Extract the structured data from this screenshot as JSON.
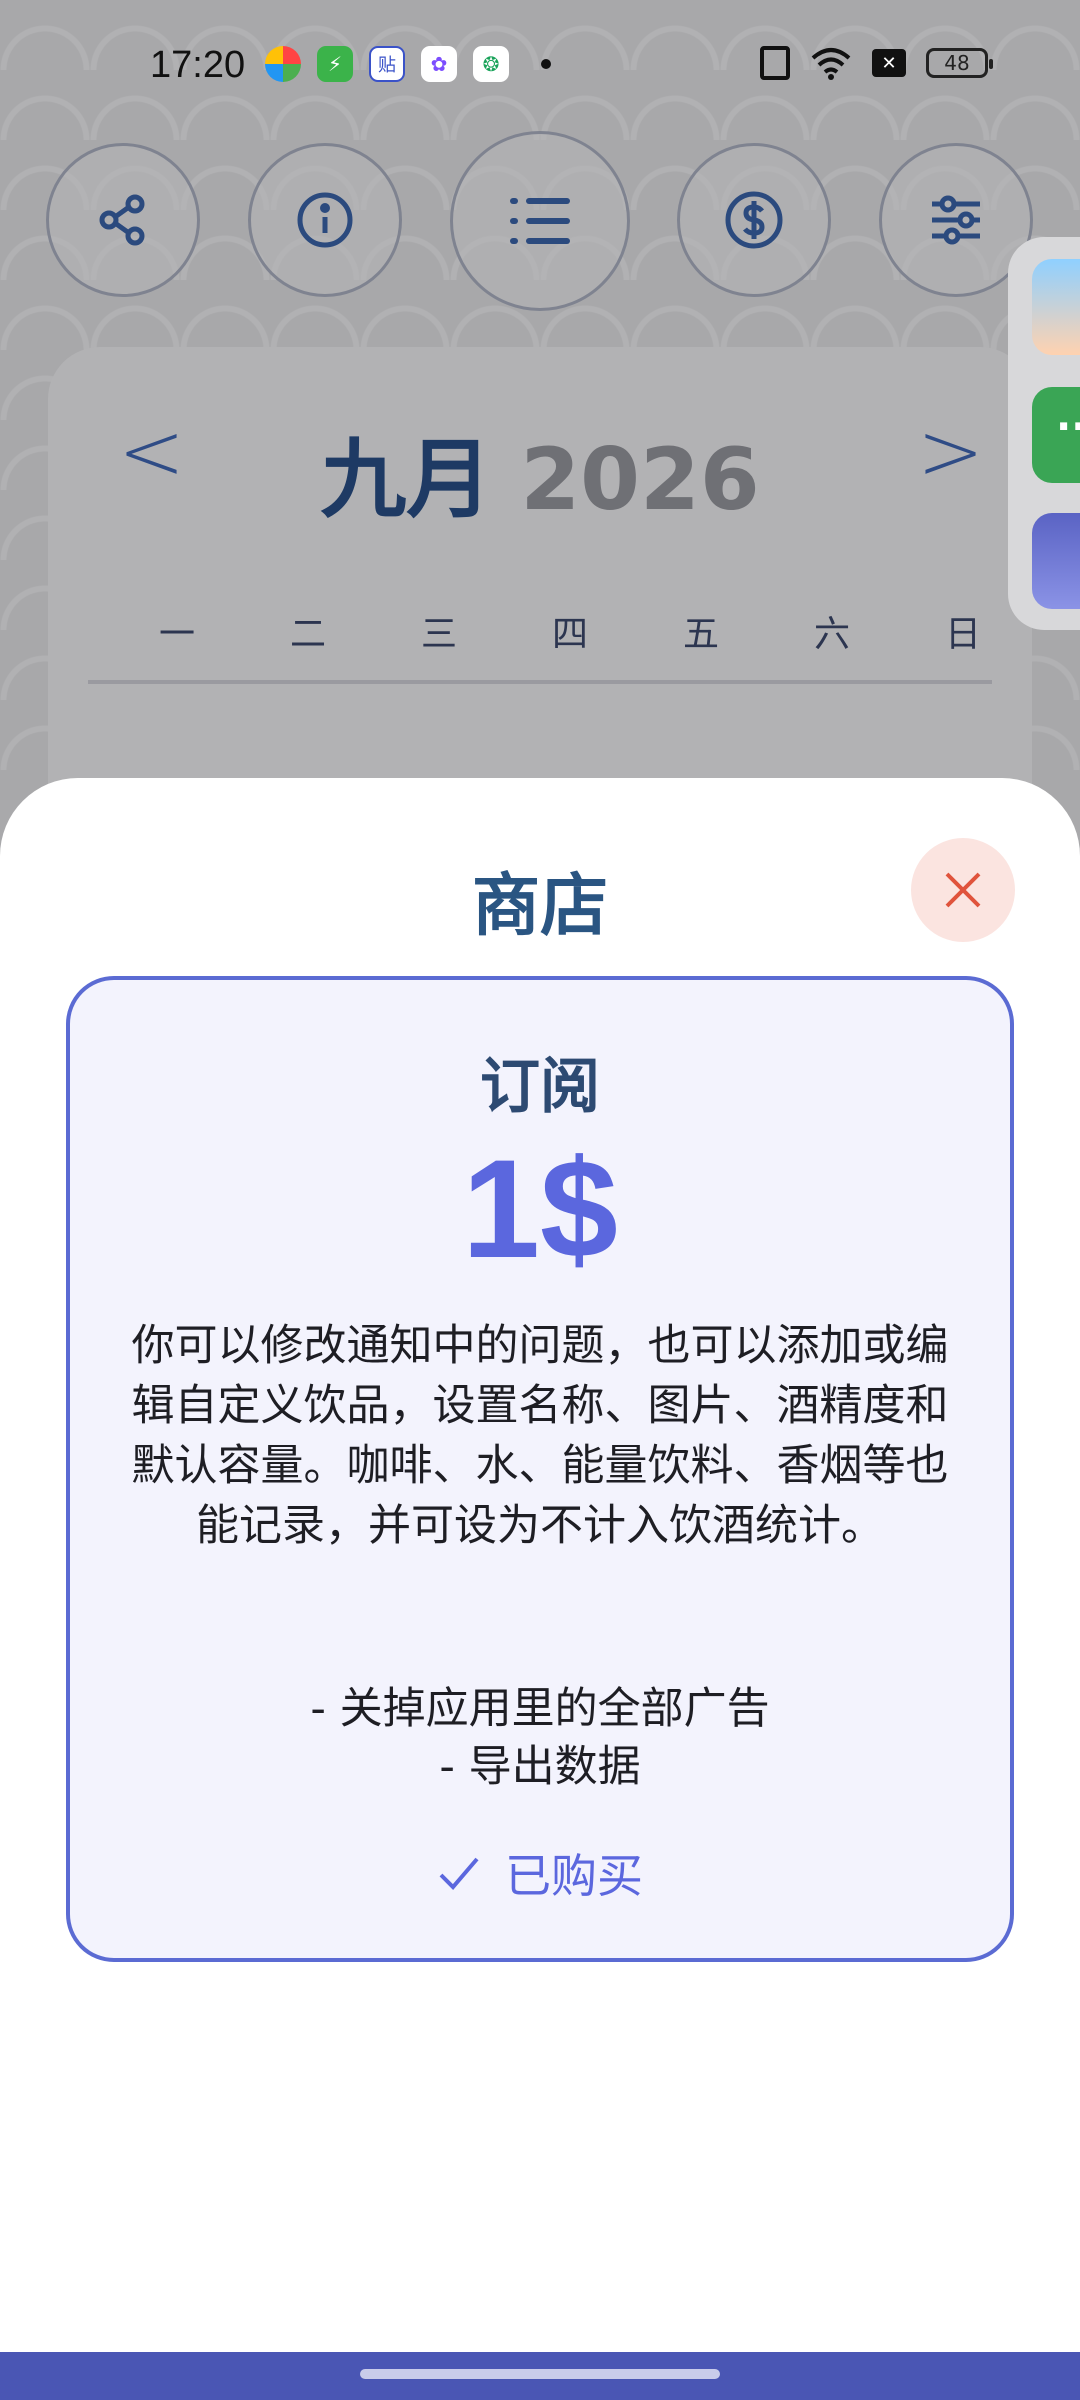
{
  "status_bar": {
    "time": "17:20",
    "battery": "48",
    "notification_icons": [
      "color-wheel-app-icon",
      "shield-bolt-app-icon",
      "tieba-app-icon",
      "pinwheel-app-icon",
      "water-drop-app-icon"
    ]
  },
  "toolbar": {
    "buttons": [
      "share-icon",
      "info-icon",
      "list-icon",
      "dollar-icon",
      "sliders-icon"
    ]
  },
  "calendar": {
    "prev": "<",
    "next": ">",
    "month": "九月",
    "year": "2026",
    "weekdays": [
      "一",
      "二",
      "三",
      "四",
      "五",
      "六",
      "日"
    ]
  },
  "side_panel": {
    "apps": [
      "cartoon-avatar-app",
      "green-chat-app",
      "cat-app"
    ]
  },
  "shop": {
    "title": "商店",
    "subscription": {
      "title": "订阅",
      "price": "1$",
      "description": "你可以修改通知中的问题，也可以添加或编辑自定义饮品，设置名称、图片、酒精度和默认容量。咖啡、水、能量饮料、香烟等也能记录，并可设为不计入饮酒统计。",
      "features": [
        "- 关掉应用里的全部广告",
        "- 导出数据"
      ],
      "status": "已购买"
    }
  },
  "colors": {
    "accent": "#5b67de",
    "title_blue": "#2a5582",
    "close_bg": "#fbe4e0",
    "close_x": "#e0533c",
    "nav_bar": "#4a56b4"
  }
}
